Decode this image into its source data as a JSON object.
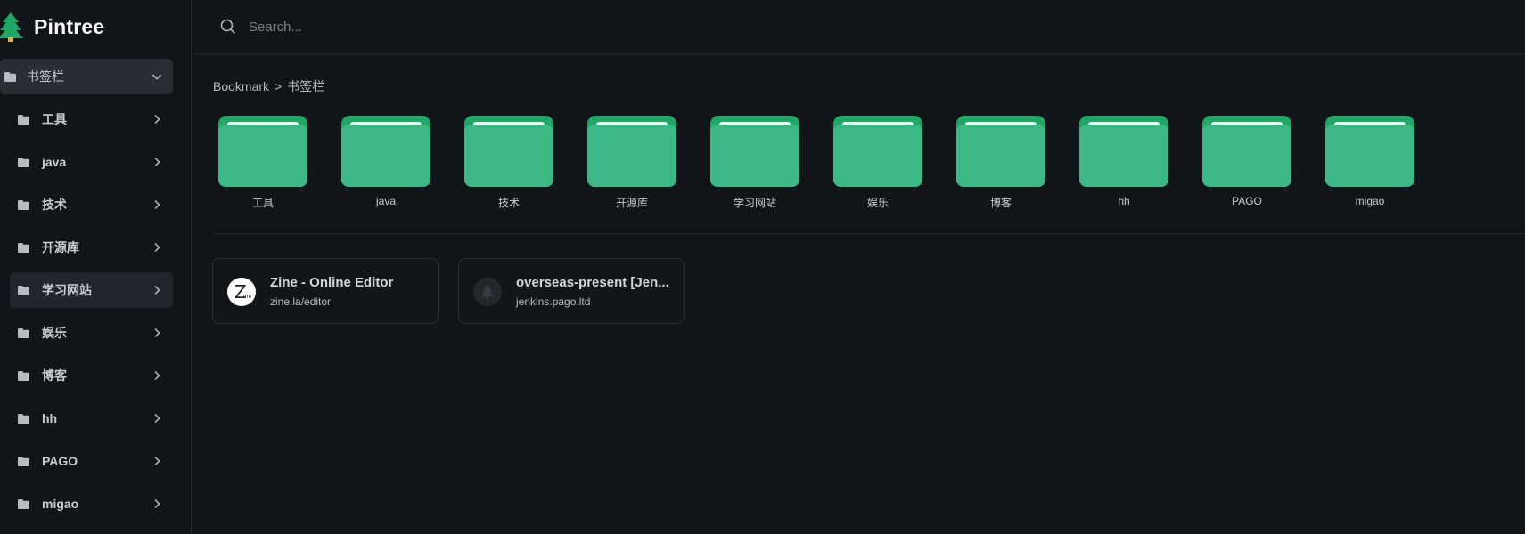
{
  "app": {
    "name": "Pintree",
    "colors": {
      "accent": "#1fa865",
      "folder_front": "#3cb885",
      "background": "#111418"
    }
  },
  "search": {
    "placeholder": "Search..."
  },
  "sidebar": {
    "root": {
      "label": "书签栏",
      "icon": "folder-icon",
      "expanded": true
    },
    "items": [
      {
        "label": "工具",
        "icon": "folder-icon"
      },
      {
        "label": "java",
        "icon": "folder-icon"
      },
      {
        "label": "技术",
        "icon": "folder-icon"
      },
      {
        "label": "开源库",
        "icon": "folder-icon"
      },
      {
        "label": "学习网站",
        "icon": "folder-icon",
        "active": true
      },
      {
        "label": "娱乐",
        "icon": "folder-icon"
      },
      {
        "label": "博客",
        "icon": "folder-icon"
      },
      {
        "label": "hh",
        "icon": "folder-icon"
      },
      {
        "label": "PAGO",
        "icon": "folder-icon"
      },
      {
        "label": "migao",
        "icon": "folder-icon"
      }
    ]
  },
  "breadcrumb": {
    "root": "Bookmark",
    "separator": ">",
    "current": "书签栏"
  },
  "folders": [
    {
      "name": "工具"
    },
    {
      "name": "java"
    },
    {
      "name": "技术"
    },
    {
      "name": "开源库"
    },
    {
      "name": "学习网站"
    },
    {
      "name": "娱乐"
    },
    {
      "name": "博客"
    },
    {
      "name": "hh"
    },
    {
      "name": "PAGO"
    },
    {
      "name": "migao"
    }
  ],
  "bookmarks": [
    {
      "title": "Zine - Online Editor",
      "url": "zine.la/editor",
      "icon": "zine-favicon",
      "favicon_text": "Z",
      "favicon_subtext": "ine"
    },
    {
      "title": "overseas-present [Jen...",
      "url": "jenkins.pago.ltd",
      "icon": "jenkins-favicon"
    }
  ]
}
